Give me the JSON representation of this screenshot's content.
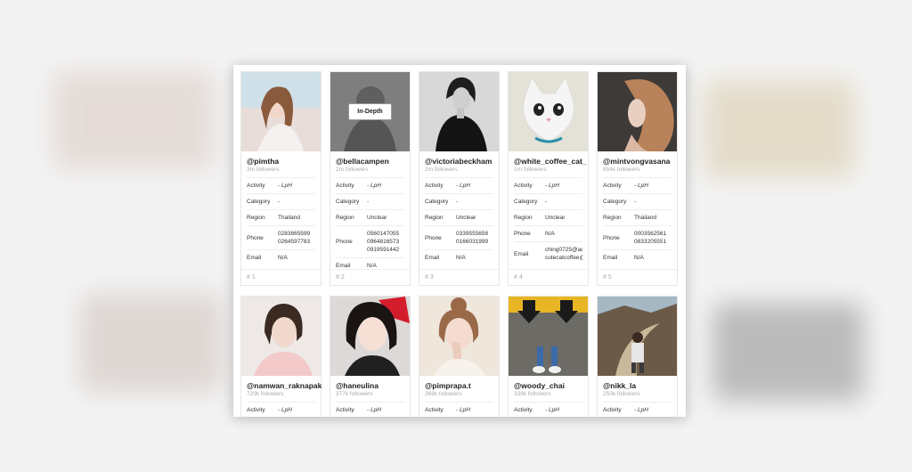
{
  "labels": {
    "activity": "Activity",
    "category": "Category",
    "region": "Region",
    "phone": "Phone",
    "email": "Email"
  },
  "hover_button": "In-Depth",
  "cards": [
    {
      "handle": "@pimtha",
      "followers": "3m followers",
      "activity": "- LpH",
      "category": "-",
      "region": "Thailand",
      "phone": "0283865599\n0264597783",
      "email": "N/A",
      "rank": "# 1"
    },
    {
      "handle": "@bellacampen",
      "followers": "2m followers",
      "activity": "- LpH",
      "category": "-",
      "region": "Unclear",
      "phone": "0560147055\n0964816573\n0919591442",
      "email": "N/A",
      "rank": "# 2"
    },
    {
      "handle": "@victoriabeckham",
      "followers": "2m followers",
      "activity": "- LpH",
      "category": "-",
      "region": "Unclear",
      "phone": "0339555658\n0166031999",
      "email": "N/A",
      "rank": "# 3"
    },
    {
      "handle": "@white_coffee_cat_",
      "followers": "1m followers",
      "activity": "- LpH",
      "category": "-",
      "region": "Unclear",
      "phone": "N/A",
      "email": "ching0725@adm\ncutecatcoffee@g",
      "rank": "# 4"
    },
    {
      "handle": "@mintvongvasana",
      "followers": "854k followers",
      "activity": "- LpH",
      "category": "-",
      "region": "Thailand",
      "phone": "0003562561\n0833205551",
      "email": "N/A",
      "rank": "# 5"
    },
    {
      "handle": "@namwan_raknapak",
      "followers": "729k followers",
      "activity": "- LpH"
    },
    {
      "handle": "@haneulina",
      "followers": "377k followers",
      "activity": "- LpH"
    },
    {
      "handle": "@pimprapa.t",
      "followers": "368k followers",
      "activity": "- LpH"
    },
    {
      "handle": "@woody_chai",
      "followers": "338k followers",
      "activity": "- LpH"
    },
    {
      "handle": "@nikk_la",
      "followers": "250k followers",
      "activity": "- LpH"
    }
  ]
}
